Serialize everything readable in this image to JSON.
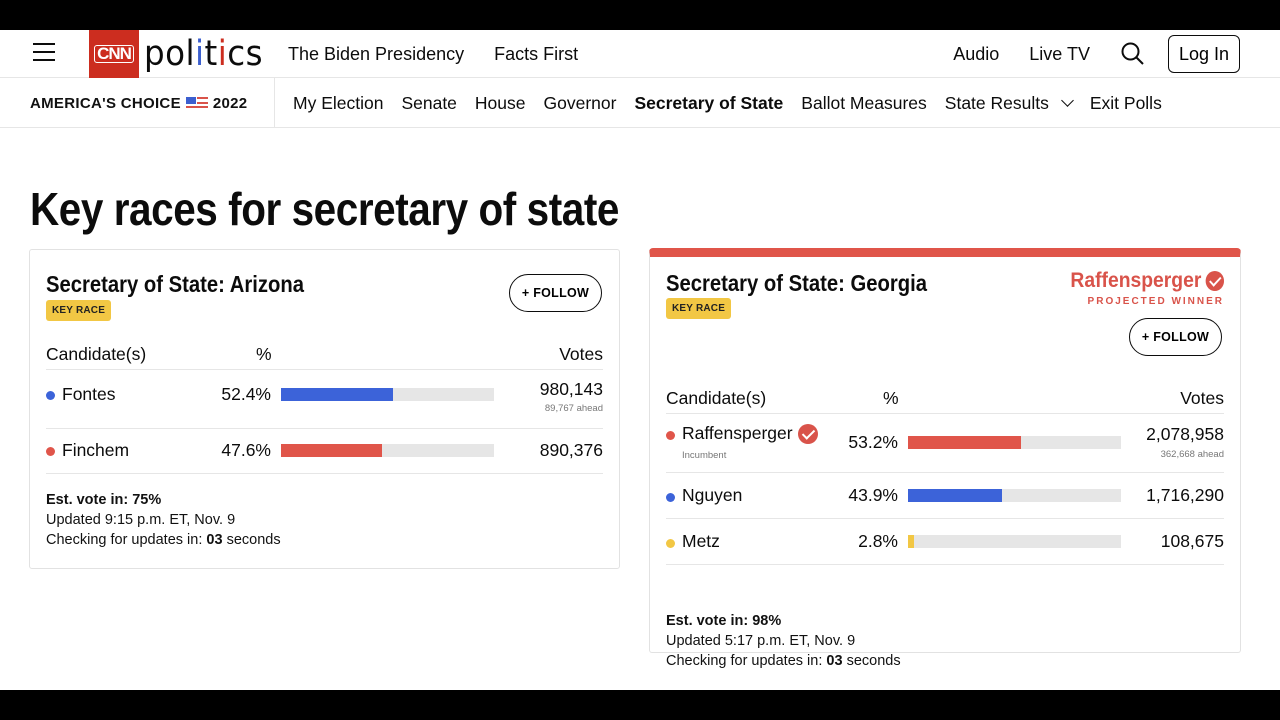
{
  "header": {
    "logo_brand": "CNN",
    "logo_section_parts": [
      "pol",
      "i",
      "t",
      "i",
      "cs"
    ],
    "nav_left": [
      "The Biden Presidency",
      "Facts First"
    ],
    "nav_right": [
      "Audio",
      "Live TV"
    ],
    "search_icon": "search-icon",
    "login_label": "Log In"
  },
  "subnav": {
    "brand_left": "AMERICA'S CHOICE",
    "brand_year": "2022",
    "items": [
      {
        "label": "My Election",
        "active": false
      },
      {
        "label": "Senate",
        "active": false
      },
      {
        "label": "House",
        "active": false
      },
      {
        "label": "Governor",
        "active": false
      },
      {
        "label": "Secretary of State",
        "active": true
      },
      {
        "label": "Ballot Measures",
        "active": false
      },
      {
        "label": "State Results",
        "active": false,
        "dropdown": true
      },
      {
        "label": "Exit Polls",
        "active": false
      }
    ]
  },
  "page_title": "Key races for secretary of state",
  "colors": {
    "dem": "#3c63d9",
    "rep": "#e0554a",
    "other": "#f2c744",
    "brand_red": "#cc2d1f",
    "bar_bg": "#e6e6e6"
  },
  "races": [
    {
      "title": "Secretary of State: Arizona",
      "badge": "KEY RACE",
      "follow_label": "+ FOLLOW",
      "winner": null,
      "columns": {
        "candidate": "Candidate(s)",
        "pct": "%",
        "votes": "Votes"
      },
      "candidates": [
        {
          "name": "Fontes",
          "party": "dem",
          "pct": 52.4,
          "pct_label": "52.4%",
          "votes": "980,143",
          "ahead": "89,767 ahead",
          "sub": null,
          "winner": false
        },
        {
          "name": "Finchem",
          "party": "rep",
          "pct": 47.6,
          "pct_label": "47.6%",
          "votes": "890,376",
          "ahead": null,
          "sub": null,
          "winner": false
        }
      ],
      "est_vote_label": "Est. vote in:",
      "est_vote_value": "75%",
      "updated": "Updated 9:15 p.m. ET, Nov. 9",
      "checking_label": "Checking for updates in:",
      "checking_value": "03",
      "checking_unit": "seconds"
    },
    {
      "title": "Secretary of State: Georgia",
      "badge": "KEY RACE",
      "follow_label": "+ FOLLOW",
      "winner": {
        "name": "Raffensperger",
        "label": "PROJECTED WINNER"
      },
      "columns": {
        "candidate": "Candidate(s)",
        "pct": "%",
        "votes": "Votes"
      },
      "candidates": [
        {
          "name": "Raffensperger",
          "party": "rep",
          "pct": 53.2,
          "pct_label": "53.2%",
          "votes": "2,078,958",
          "ahead": "362,668 ahead",
          "sub": "Incumbent",
          "winner": true
        },
        {
          "name": "Nguyen",
          "party": "dem",
          "pct": 43.9,
          "pct_label": "43.9%",
          "votes": "1,716,290",
          "ahead": null,
          "sub": null,
          "winner": false
        },
        {
          "name": "Metz",
          "party": "other",
          "pct": 2.8,
          "pct_label": "2.8%",
          "votes": "108,675",
          "ahead": null,
          "sub": null,
          "winner": false
        }
      ],
      "est_vote_label": "Est. vote in:",
      "est_vote_value": "98%",
      "updated": "Updated 5:17 p.m. ET, Nov. 9",
      "checking_label": "Checking for updates in:",
      "checking_value": "03",
      "checking_unit": "seconds"
    }
  ]
}
